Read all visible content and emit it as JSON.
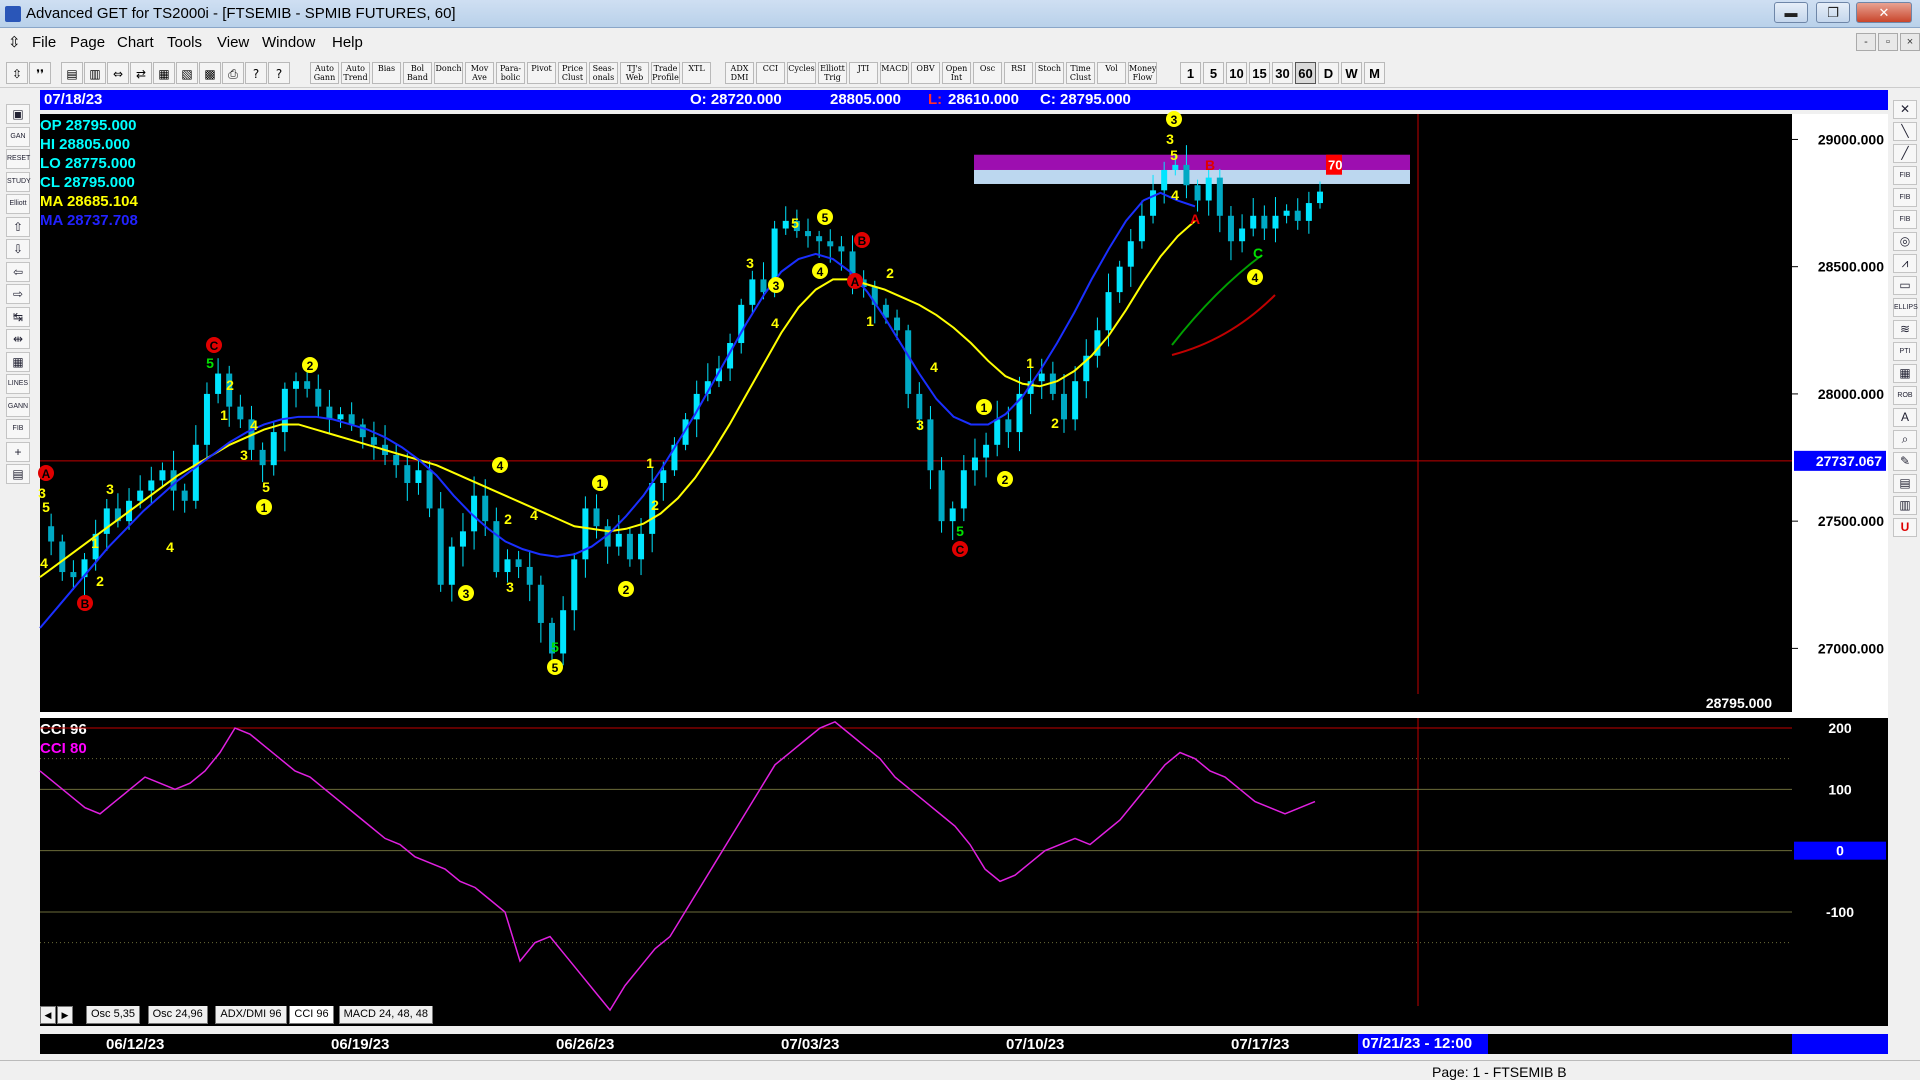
{
  "window": {
    "title": "Advanced GET for TS2000i - [FTSEMIB - SPMIB FUTURES, 60]",
    "min_label": "▬",
    "max_label": "❐",
    "close_label": "✕"
  },
  "menu": {
    "items": [
      "File",
      "Page",
      "Chart",
      "Tools",
      "View",
      "Window",
      "Help"
    ],
    "mdi": [
      "-",
      "▫",
      "×"
    ]
  },
  "toolbar": {
    "icons": [
      "⇳",
      "❜❜",
      "▤",
      "▥",
      "⇔",
      "⇄",
      "▦",
      "▧",
      "▩",
      "⎙",
      "?",
      "?"
    ],
    "studies": [
      "Auto Gann",
      "Auto Trend",
      "Bias",
      "Bol Band",
      "Donch",
      "Mov Ave",
      "Para-bolic",
      "Pivot",
      "Price Clust",
      "Seas-onals",
      "TJ's Web",
      "Trade Profile",
      "XTL",
      "ADX DMI",
      "CCI",
      "Cycles",
      "Elliott Trig",
      "JTI",
      "MACD",
      "OBV",
      "Open Int",
      "Osc",
      "RSI",
      "Stoch",
      "Time Clust",
      "Vol",
      "Money Flow"
    ],
    "periods": [
      "1",
      "5",
      "10",
      "15",
      "30",
      "60",
      "D",
      "W",
      "M"
    ],
    "active_period": "60"
  },
  "left_tools": [
    "▣",
    "GAN",
    "RESET",
    "STUDY",
    "Elliott",
    "⇧",
    "⇩",
    "⇦",
    "⇨",
    "↹",
    "⇹",
    "▦",
    "LINES",
    "GANN",
    "FIB",
    "+",
    "▤"
  ],
  "right_tools": [
    "✕",
    "╲",
    "╱",
    "FIB RET",
    "FIB EXT",
    "FIB TIME",
    "◎",
    "⩘",
    "▭",
    "ELLIPS",
    "≋",
    "PTI",
    "▦",
    "ROB",
    "A",
    "⌕",
    "✎",
    "▤",
    "▥",
    "U"
  ],
  "infobar": {
    "date": "07/18/23",
    "open": "O: 28720.000",
    "high": "28805.000",
    "low_prefix": "L:",
    "low": "28610.000",
    "close": "C: 28795.000"
  },
  "price_panel": {
    "labels": [
      {
        "text": "OP  28795.000",
        "color": "#00ffff"
      },
      {
        "text": "HI   28805.000",
        "color": "#00ffff"
      },
      {
        "text": "LO  28775.000",
        "color": "#00ffff"
      },
      {
        "text": "CL  28795.000",
        "color": "#00ffff"
      },
      {
        "text": "MA  28685.104",
        "color": "#ffff00"
      },
      {
        "text": "MA  28737.708",
        "color": "#2222ff"
      }
    ],
    "last_price": "28795.000",
    "cursor_price": "27737.067",
    "band_label": "70"
  },
  "cci_panel": {
    "labels": [
      {
        "text": "CCI 96",
        "color": "#ffffff"
      },
      {
        "text": "CCI  80",
        "color": "#ff00ff"
      }
    ]
  },
  "chart_data": [
    {
      "type": "candlestick",
      "ylim": [
        26750,
        29100
      ],
      "yticks": [
        27000,
        27500,
        28000,
        28500,
        29000
      ],
      "ytick_labels": [
        "27000.000",
        "27500.000",
        "28000.000",
        "28500.000",
        "29000.000"
      ],
      "dates": [
        "06/12/23",
        "06/19/23",
        "06/26/23",
        "07/03/23",
        "07/10/23",
        "07/17/23"
      ],
      "cursor_date": "07/21/23 - 12:00",
      "close_series": [
        27480,
        27420,
        27300,
        27280,
        27350,
        27450,
        27550,
        27500,
        27580,
        27620,
        27660,
        27700,
        27620,
        27580,
        27800,
        28000,
        28080,
        27950,
        27900,
        27780,
        27720,
        27850,
        28020,
        28050,
        28020,
        27950,
        27900,
        27920,
        27880,
        27830,
        27800,
        27760,
        27720,
        27650,
        27700,
        27550,
        27250,
        27400,
        27460,
        27600,
        27500,
        27300,
        27350,
        27320,
        27250,
        27100,
        26980,
        27150,
        27350,
        27550,
        27480,
        27400,
        27450,
        27350,
        27450,
        27650,
        27700,
        27800,
        27900,
        28000,
        28050,
        28100,
        28200,
        28350,
        28450,
        28400,
        28650,
        28680,
        28640,
        28620,
        28600,
        28580,
        28560,
        28450,
        28420,
        28350,
        28300,
        28250,
        28000,
        27900,
        27700,
        27500,
        27550,
        27700,
        27750,
        27800,
        27900,
        27850,
        28000,
        28050,
        28080,
        28000,
        27900,
        28050,
        28150,
        28250,
        28400,
        28500,
        28600,
        28700,
        28800,
        28880,
        28900,
        28820,
        28760,
        28850,
        28700,
        28600,
        28650,
        28700,
        28650,
        28700,
        28720,
        28680,
        28750,
        28795
      ],
      "ma_yellow": [
        27280,
        27330,
        27380,
        27430,
        27480,
        27530,
        27580,
        27630,
        27680,
        27720,
        27760,
        27800,
        27830,
        27860,
        27880,
        27880,
        27860,
        27840,
        27820,
        27800,
        27780,
        27760,
        27740,
        27720,
        27690,
        27660,
        27630,
        27600,
        27570,
        27540,
        27510,
        27480,
        27470,
        27460,
        27470,
        27490,
        27530,
        27590,
        27670,
        27770,
        27880,
        28000,
        28120,
        28240,
        28340,
        28410,
        28450,
        28450,
        28430,
        28410,
        28380,
        28350,
        28310,
        28260,
        28200,
        28130,
        28070,
        28040,
        28030,
        28050,
        28090,
        28150,
        28230,
        28330,
        28440,
        28540,
        28620,
        28680
      ],
      "ma_blue": [
        27080,
        27160,
        27240,
        27320,
        27400,
        27470,
        27540,
        27600,
        27660,
        27710,
        27760,
        27810,
        27850,
        27880,
        27900,
        27910,
        27910,
        27900,
        27880,
        27860,
        27830,
        27790,
        27740,
        27680,
        27600,
        27530,
        27470,
        27420,
        27390,
        27370,
        27360,
        27370,
        27400,
        27450,
        27520,
        27600,
        27700,
        27810,
        27920,
        28040,
        28160,
        28280,
        28390,
        28480,
        28530,
        28550,
        28530,
        28480,
        28400,
        28300,
        28190,
        28080,
        27980,
        27910,
        27880,
        27880,
        27920,
        27990,
        28090,
        28200,
        28320,
        28450,
        28570,
        28680,
        28760,
        28790,
        28760,
        28737
      ]
    },
    {
      "type": "line",
      "name": "CCI 80",
      "ylim": [
        -250,
        200
      ],
      "yticks": [
        200,
        100,
        0,
        -100
      ],
      "ytick_labels": [
        "200",
        "100",
        "0",
        "-100"
      ],
      "values": [
        130,
        110,
        90,
        70,
        60,
        80,
        100,
        120,
        110,
        100,
        110,
        130,
        160,
        200,
        190,
        170,
        150,
        130,
        120,
        100,
        80,
        60,
        40,
        20,
        10,
        -10,
        -20,
        -30,
        -50,
        -60,
        -80,
        -100,
        -180,
        -150,
        -140,
        -170,
        -200,
        -230,
        -260,
        -220,
        -190,
        -160,
        -140,
        -100,
        -60,
        -20,
        20,
        60,
        100,
        140,
        160,
        180,
        200,
        210,
        190,
        170,
        150,
        120,
        100,
        80,
        60,
        40,
        10,
        -30,
        -50,
        -40,
        -20,
        0,
        10,
        20,
        10,
        30,
        50,
        80,
        110,
        140,
        160,
        150,
        130,
        120,
        100,
        80,
        70,
        60,
        70,
        80
      ]
    }
  ]
}
